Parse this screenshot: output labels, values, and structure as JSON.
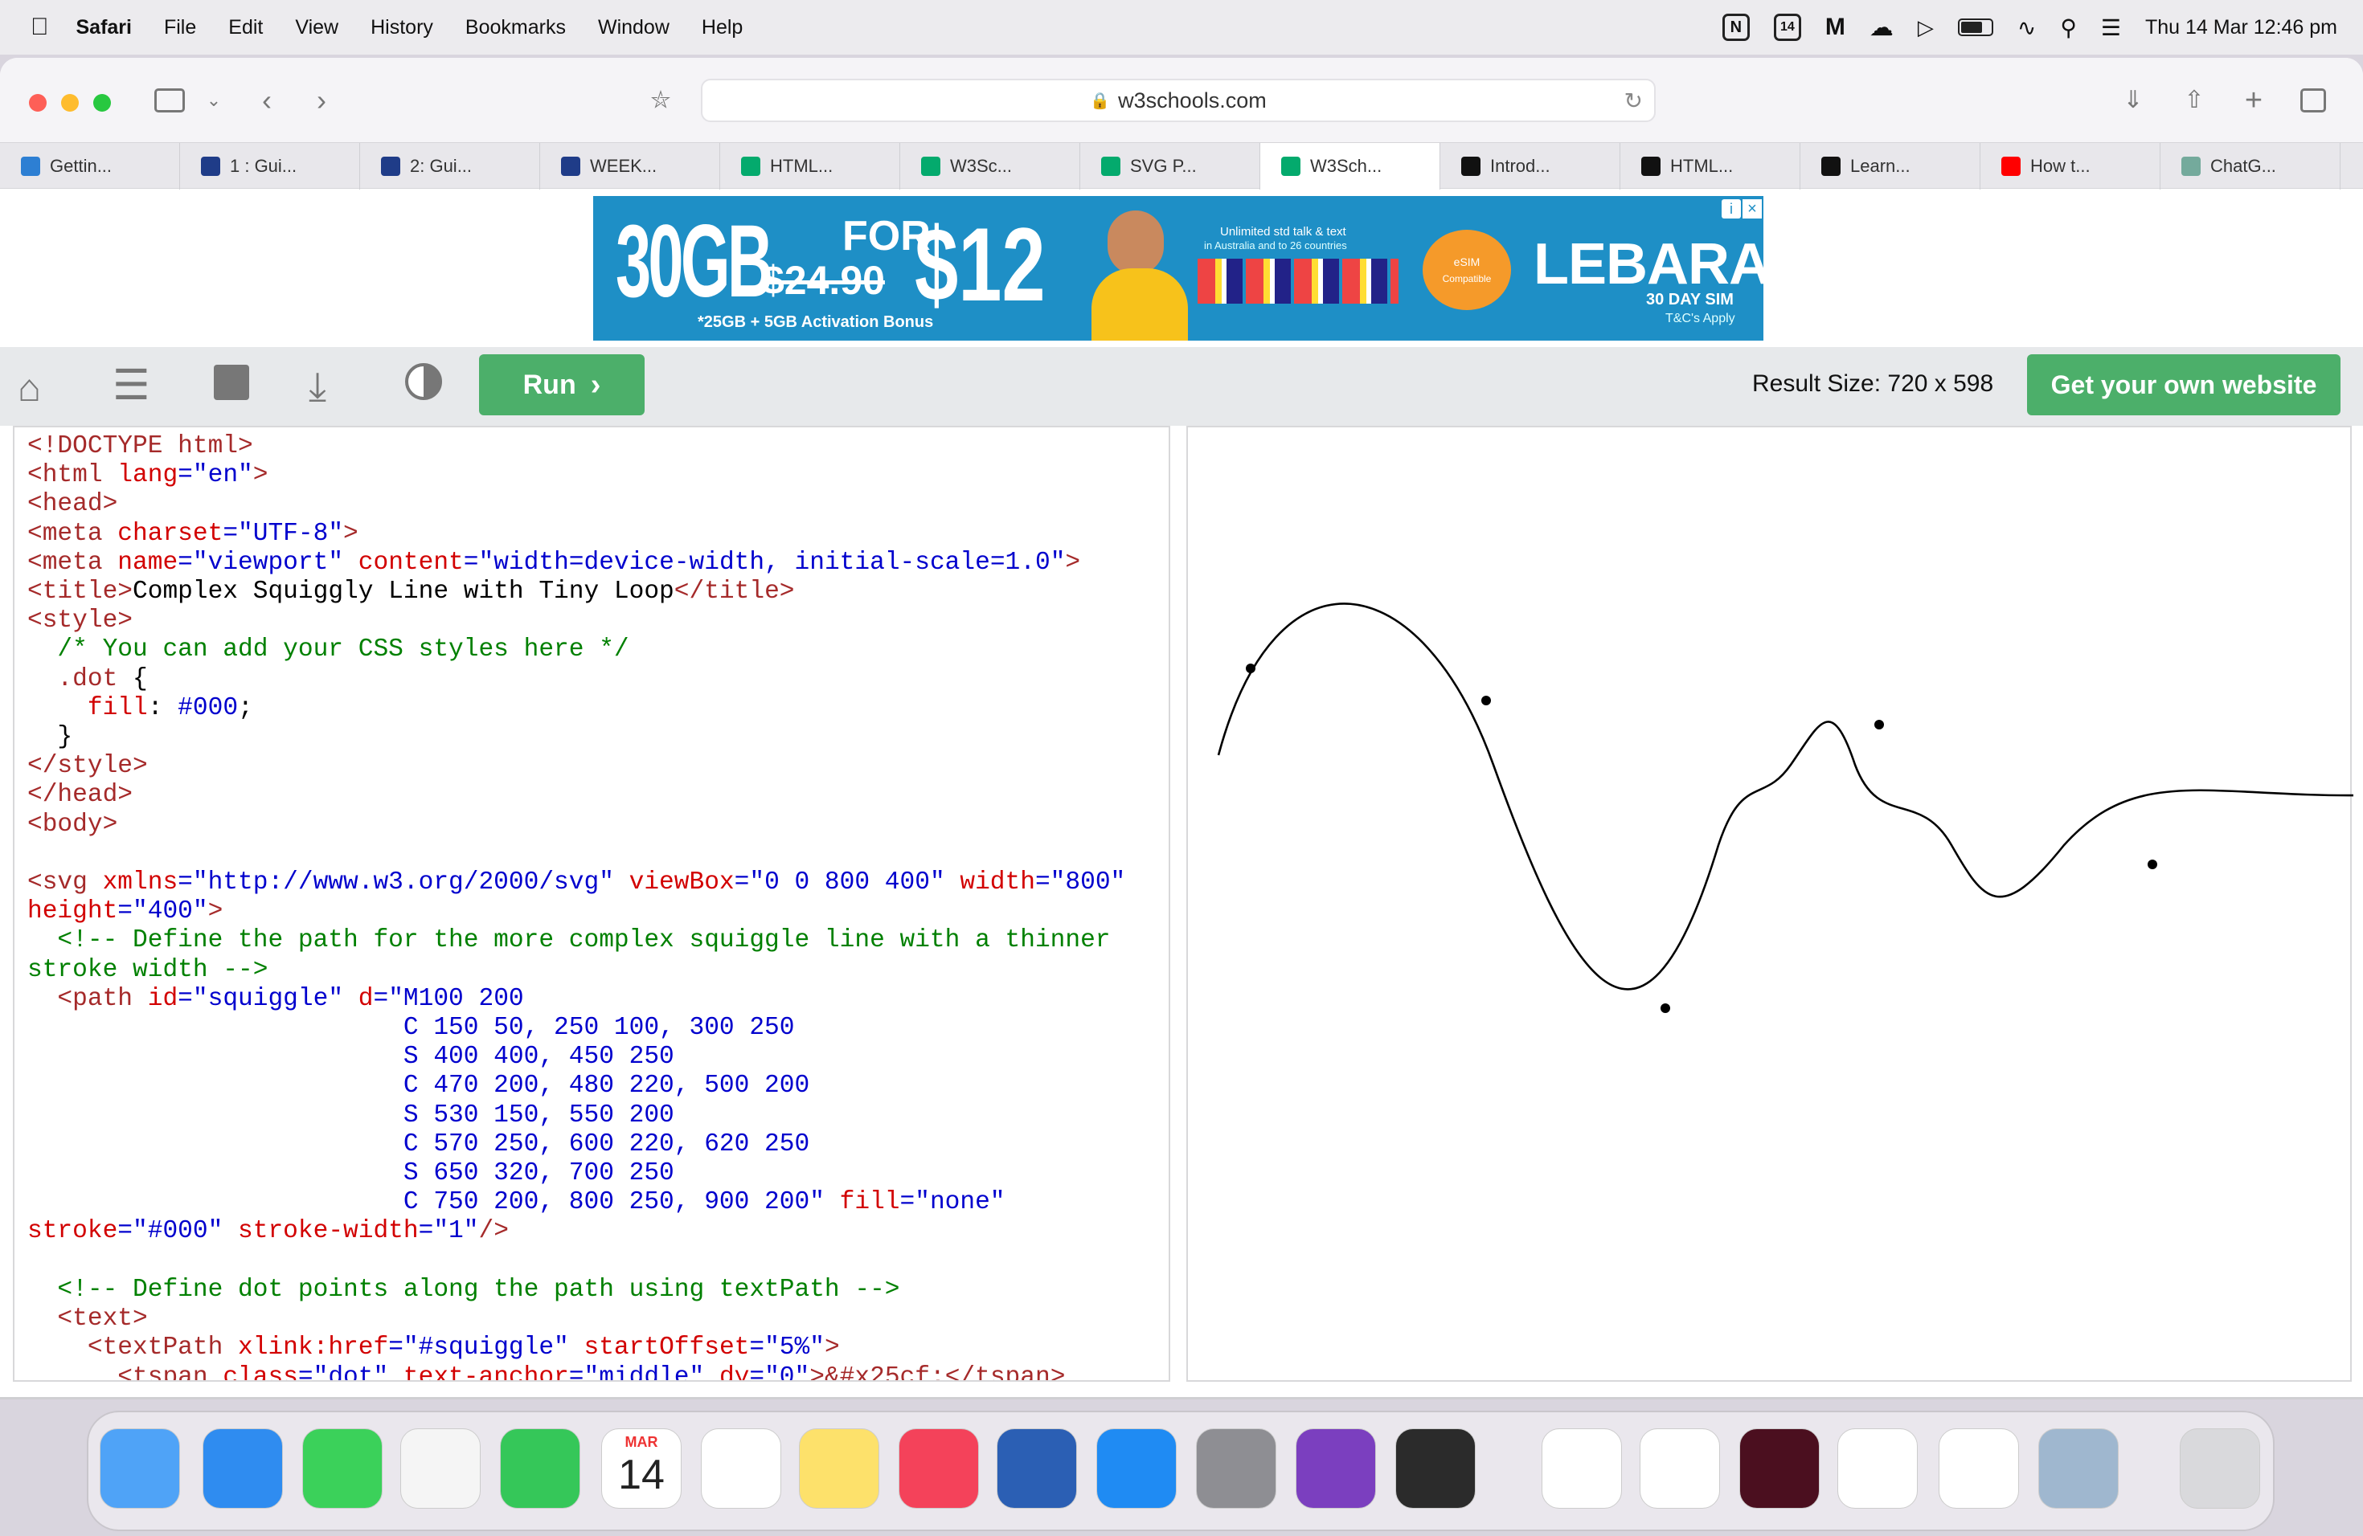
{
  "menubar": {
    "app": "Safari",
    "items": [
      "File",
      "Edit",
      "View",
      "History",
      "Bookmarks",
      "Window",
      "Help"
    ],
    "status": {
      "calendar_day": "14",
      "datetime": "Thu 14 Mar  12:46 pm"
    }
  },
  "browser": {
    "address": "w3schools.com",
    "tabs": [
      {
        "label": "Gettin...",
        "icon": "vscode-icon",
        "color": "#2d7fd3"
      },
      {
        "label": "1 : Gui...",
        "icon": "university-icon",
        "color": "#1f3c88"
      },
      {
        "label": "2: Gui...",
        "icon": "university-icon",
        "color": "#1f3c88"
      },
      {
        "label": "WEEK...",
        "icon": "university-icon",
        "color": "#1f3c88"
      },
      {
        "label": "HTML...",
        "icon": "w3schools-icon",
        "color": "#04aa6d"
      },
      {
        "label": "W3Sc...",
        "icon": "w3schools-icon",
        "color": "#04aa6d"
      },
      {
        "label": "SVG P...",
        "icon": "w3schools-icon",
        "color": "#04aa6d"
      },
      {
        "label": "W3Sch...",
        "icon": "w3schools-icon",
        "color": "#04aa6d",
        "active": true
      },
      {
        "label": "Introd...",
        "icon": "m-logo-icon",
        "color": "#111111"
      },
      {
        "label": "HTML...",
        "icon": "m-logo-icon",
        "color": "#111111"
      },
      {
        "label": "Learn...",
        "icon": "a-logo-icon",
        "color": "#111111"
      },
      {
        "label": "How t...",
        "icon": "youtube-icon",
        "color": "#ff0000"
      },
      {
        "label": "ChatG...",
        "icon": "openai-icon",
        "color": "#74aa9c"
      }
    ]
  },
  "ad": {
    "big": "30GB",
    "strike": "$24.90",
    "for": "FOR",
    "price": "$12",
    "bonus": "*25GB + 5GB Activation Bonus",
    "line1": "Unlimited std talk & text",
    "line2": "in Australia and to 26 countries",
    "esim": "eSIM",
    "compat": "Compatible",
    "brand": "LEBARA",
    "sim": "30 DAY SIM",
    "tc": "T&C's Apply"
  },
  "tryit": {
    "run_label": "Run",
    "result_size": "Result Size: 720 x 598",
    "get_website": "Get your own website"
  },
  "code": {
    "l1": "<!DOCTYPE html>",
    "l2a": "<html ",
    "l2b": "lang",
    "l2c": "=\"en\"",
    "l2d": ">",
    "l3": "<head>",
    "l4a": "<meta ",
    "l4b": "charset",
    "l4c": "=\"UTF-8\"",
    "l4d": ">",
    "l5a": "<meta ",
    "l5b": "name",
    "l5c": "=\"viewport\" ",
    "l5d": "content",
    "l5e": "=\"width=device-width, initial-scale=1.0\"",
    "l5f": ">",
    "l6a": "<title>",
    "l6b": "Complex Squiggly Line with Tiny Loop",
    "l6c": "</title>",
    "l7": "<style>",
    "l8": "  /* You can add your CSS styles here */",
    "l9a": "  .dot",
    "l9b": " {",
    "l10a": "    fill",
    "l10b": ": ",
    "l10c": "#000",
    "l10d": ";",
    "l11": "  }",
    "l12": "</style>",
    "l13": "</head>",
    "l14": "<body>",
    "l16a": "<svg ",
    "l16b": "xmlns",
    "l16c": "=\"http://www.w3.org/2000/svg\" ",
    "l16d": "viewBox",
    "l16e": "=\"0 0 800 400\" ",
    "l16f": "width",
    "l16g": "=\"800\"",
    "l17a": "height",
    "l17b": "=\"400\"",
    "l17c": ">",
    "l18": "  <!-- Define the path for the more complex squiggle line with a thinner",
    "l19": "stroke width -->",
    "l20a": "  <path ",
    "l20b": "id",
    "l20c": "=\"squiggle\" ",
    "l20d": "d",
    "l20e": "=\"M100 200",
    "l21": "                         C 150 50, 250 100, 300 250",
    "l22": "                         S 400 400, 450 250",
    "l23": "                         C 470 200, 480 220, 500 200",
    "l24": "                         S 530 150, 550 200",
    "l25": "                         C 570 250, 600 220, 620 250",
    "l26": "                         S 650 320, 700 250",
    "l27a": "                         C 750 200, 800 250, 900 200\" ",
    "l27b": "fill",
    "l27c": "=\"none\"",
    "l28a": "stroke",
    "l28b": "=\"#000\" ",
    "l28c": "stroke-width",
    "l28d": "=\"1\"",
    "l28e": "/>",
    "l30": "  <!-- Define dot points along the path using textPath -->",
    "l31": "  <text>",
    "l32a": "    <textPath ",
    "l32b": "xlink:href",
    "l32c": "=\"#squiggle\" ",
    "l32d": "startOffset",
    "l32e": "=\"5%\"",
    "l32f": ">",
    "l33a": "      <tspan ",
    "l33b": "class",
    "l33c": "=\"dot\" ",
    "l33d": "text-anchor",
    "l33e": "=\"middle\" ",
    "l33f": "dy",
    "l33g": "=\"0\"",
    "l33h": ">&#x25cf;</tspan>"
  },
  "dock": {
    "calendar_month": "MAR",
    "calendar_day": "14",
    "apps": [
      "Finder",
      "Safari",
      "Messages",
      "Photos",
      "FaceTime",
      "Calendar",
      "Reminders",
      "Notes",
      "Music",
      "Word",
      "App Store",
      "System Settings",
      "OneNote",
      "Mirror",
      "Notion",
      "Chrome",
      "InDesign",
      "VS Code",
      "TextEdit",
      "Preview",
      "Trash"
    ]
  }
}
